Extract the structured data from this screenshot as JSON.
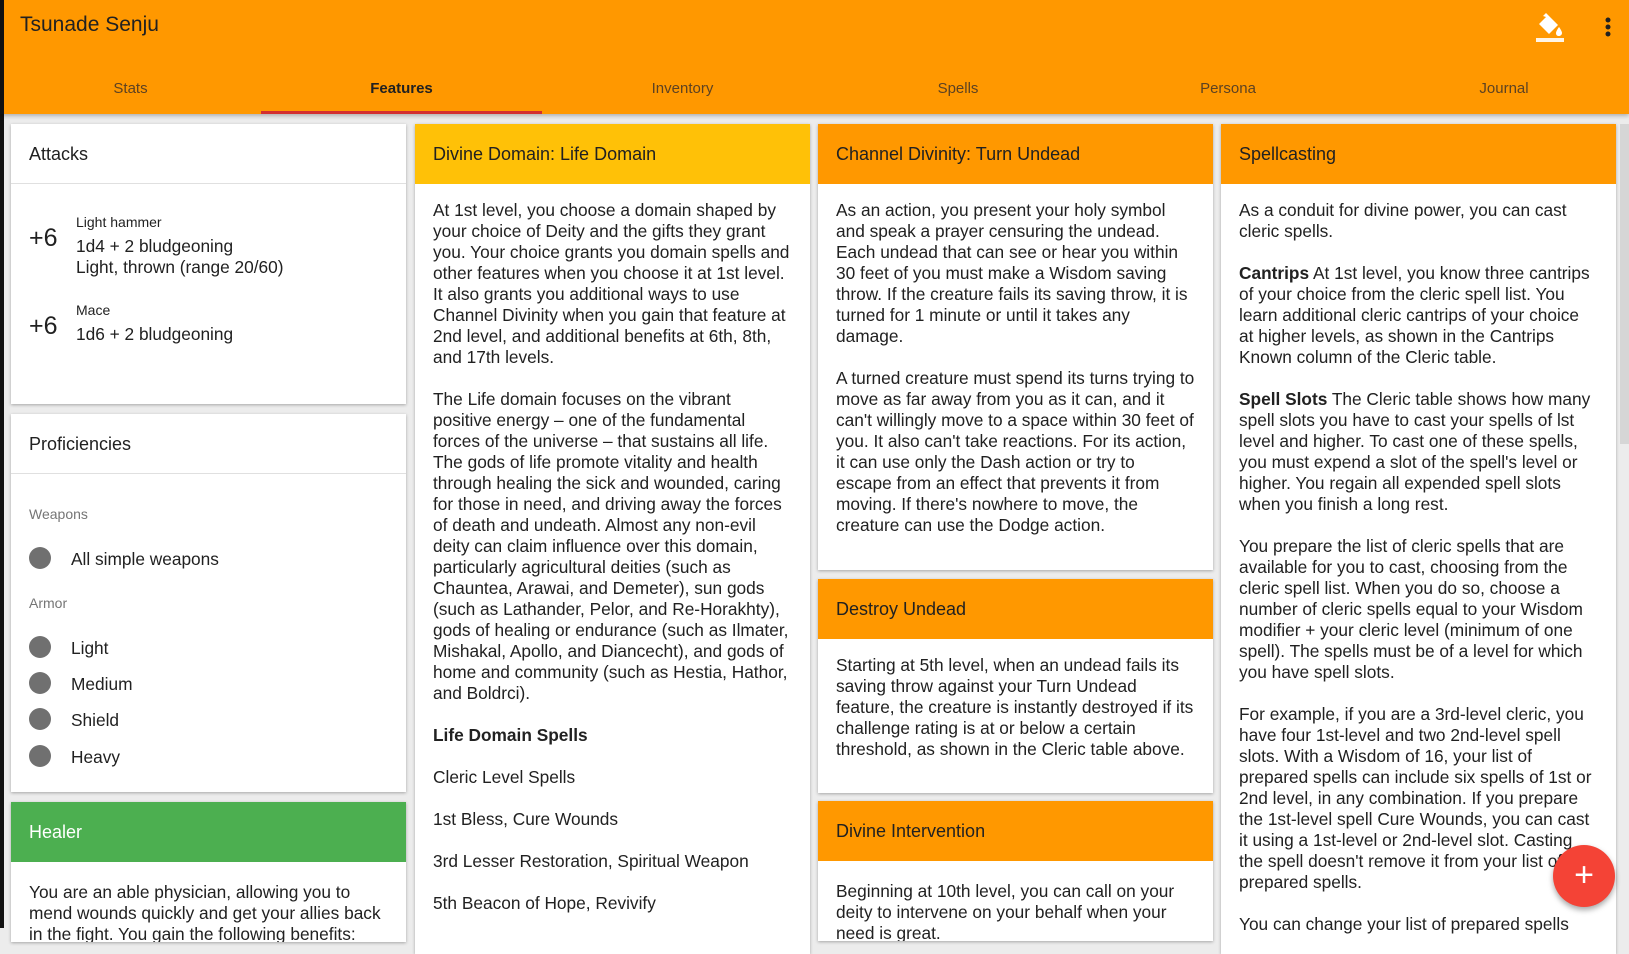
{
  "app": {
    "title": "Tsunade Senju",
    "paint_icon": "format-color-fill-icon",
    "more_icon": "more-vert-icon"
  },
  "tabs": [
    {
      "label": "Stats"
    },
    {
      "label": "Features"
    },
    {
      "label": "Inventory"
    },
    {
      "label": "Spells"
    },
    {
      "label": "Persona"
    },
    {
      "label": "Journal"
    }
  ],
  "active_tab": "Features",
  "colors": {
    "appbar": "#ff9800",
    "amber": "#ffc107",
    "green": "#4caf50",
    "fab": "#f44336",
    "tab_indicator": "#d32f2f"
  },
  "attacks": {
    "title": "Attacks",
    "items": [
      {
        "bonus": "+6",
        "name": "Light hammer",
        "damage": "1d4 + 2 bludgeoning",
        "props": "Light, thrown (range 20/60)"
      },
      {
        "bonus": "+6",
        "name": "Mace",
        "damage": "1d6 + 2 bludgeoning",
        "props": ""
      }
    ]
  },
  "proficiencies": {
    "title": "Proficiencies",
    "weapons_label": "Weapons",
    "weapons": [
      "All simple weapons"
    ],
    "armor_label": "Armor",
    "armor": [
      "Light",
      "Medium",
      "Shield",
      "Heavy"
    ]
  },
  "healer": {
    "title": "Healer",
    "text": "You are an able physician, allowing you to mend wounds quickly and get your allies back in the fight. You gain the following benefits:"
  },
  "life_domain": {
    "title": "Divine Domain: Life Domain",
    "p1": "At 1st level, you choose a domain shaped by your choice of Deity and the gifts they grant you. Your choice grants you domain spells and other features when you choose it at 1st level. It also grants you additional ways to use Channel Divinity when you gain that feature at 2nd level, and additional benefits at 6th, 8th, and 17th levels.",
    "p2": "The Life domain focuses on the vibrant positive energy – one of the fundamental forces of the universe – that sustains all life. The gods of life promote vitality and health through healing the sick and wounded, caring for those in need, and driving away the forces of death and undeath. Almost any non-evil deity can claim influence over this domain, particularly agricultural deities (such as Chauntea, Arawai, and Demeter), sun gods (such as Lathander, Pelor, and Re-Horakhty), gods of healing or endurance (such as Ilmater, Mishakal, Apollo, and Diancecht), and gods of home and community (such as Hestia, Hathor, and Boldrci).",
    "spells_heading": "Life Domain Spells",
    "spells_table_header": "Cleric Level Spells",
    "spell_rows": [
      "1st Bless, Cure Wounds",
      "3rd Lesser Restoration, Spiritual Weapon",
      "5th Beacon of Hope, Revivify"
    ]
  },
  "turn_undead": {
    "title": "Channel Divinity: Turn Undead",
    "p1": "As an action, you present your holy symbol and speak a prayer censuring the undead. Each undead that can see or hear you within 30 feet of you must make a Wisdom saving throw. If the creature fails its saving throw, it is turned for 1 minute or until it takes any damage.",
    "p2": "A turned creature must spend its turns trying to move as far away from you as it can, and it can't willingly move to a space within 30 feet of you. It also can't take reactions. For its action, it can use only the Dash action or try to escape from an effect that prevents it from moving. If there's nowhere to move, the creature can use the Dodge action."
  },
  "destroy_undead": {
    "title": "Destroy Undead",
    "p1": "Starting at 5th level, when an undead fails its saving throw against your Turn Undead feature, the creature is instantly destroyed if its challenge rating is at or below a certain threshold, as shown in the Cleric table above."
  },
  "divine_intervention": {
    "title": "Divine Intervention",
    "p1": "Beginning at 10th level, you can call on your deity to intervene on your behalf when your need is great."
  },
  "spellcasting": {
    "title": "Spellcasting",
    "p1": "As a conduit for divine power, you can cast cleric spells.",
    "cantrips_label": "Cantrips",
    "cantrips_text": " At 1st level, you know three cantrips of your choice from the cleric spell list. You learn additional cleric cantrips of your choice at higher levels, as shown in the Cantrips Known column of the Cleric table.",
    "slots_label": "Spell Slots",
    "slots_text": " The Cleric table shows how many spell slots you have to cast your spells of lst level and higher. To cast one of these spells, you must expend a slot of the spell's level or higher. You regain all expended spell slots when you finish a long rest.",
    "p4": "You prepare the list of cleric spells that are available for you to cast, choosing from the cleric spell list. When you do so, choose a number of cleric spells equal to your Wisdom modifier + your cleric level (minimum of one spell). The spells must be of a level for which you have spell slots.",
    "p5": "For example, if you are a 3rd-level cleric, you have four 1st-level and two 2nd-level spell slots. With a Wisdom of 16, your list of prepared spells can include six spells of 1st or 2nd level, in any combination. If you prepare the 1st-level spell Cure Wounds, you can cast it using a 1st-level or 2nd-level slot. Casting the spell doesn't remove it from your list of prepared spells.",
    "p6": "You can change your list of prepared spells"
  },
  "fab": {
    "label": "+",
    "icon": "add-icon"
  }
}
